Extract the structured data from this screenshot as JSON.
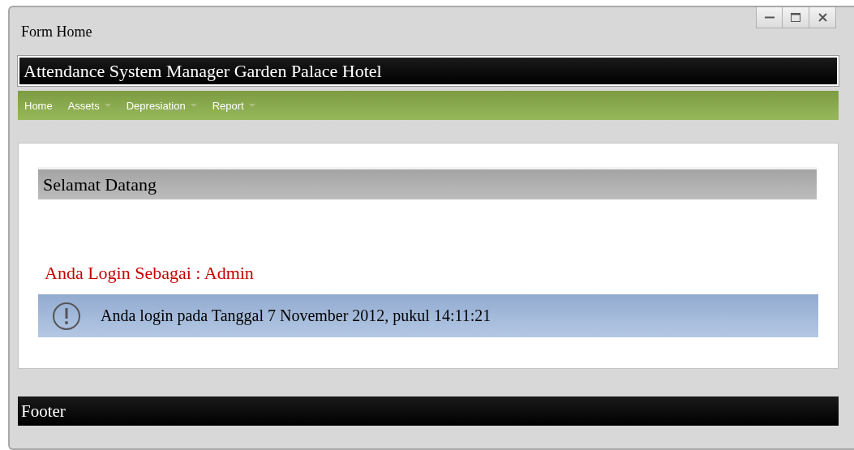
{
  "window": {
    "title": "Form Home"
  },
  "header": {
    "title": "Attendance System Manager Garden Palace Hotel"
  },
  "menu": [
    {
      "label": "Home",
      "has_submenu": false
    },
    {
      "label": "Assets",
      "has_submenu": true
    },
    {
      "label": "Depresiation",
      "has_submenu": true
    },
    {
      "label": "Report",
      "has_submenu": true
    }
  ],
  "content": {
    "heading": "Selamat Datang",
    "login_role": "Anda Login Sebagai : Admin",
    "notice": "Anda login pada Tanggal 7 November 2012, pukul 14:11:21"
  },
  "footer": {
    "text": "Footer"
  }
}
